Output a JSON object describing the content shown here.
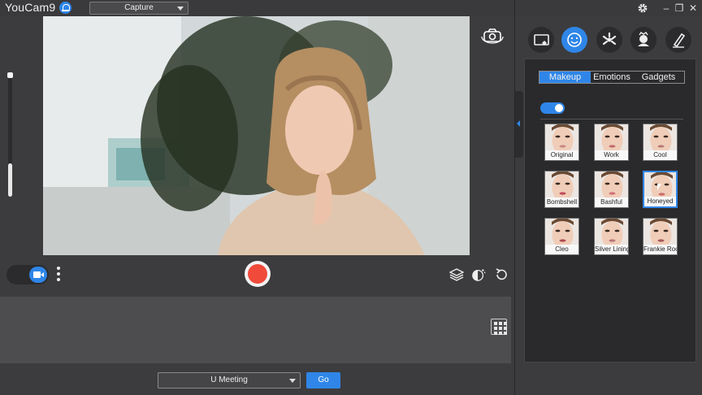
{
  "titlebar": {
    "app_title": "YouCam9",
    "mode": "Capture"
  },
  "window_controls": {
    "minimize": "–",
    "restore": "❐",
    "close": "✕"
  },
  "zoom_level": 0.27,
  "bottom": {
    "meeting_app": "U Meeting",
    "go_label": "Go"
  },
  "effects": {
    "categories": [
      "frame-icon",
      "face-icon",
      "particle-icon",
      "character-icon",
      "brush-icon"
    ],
    "active_category": 1,
    "tabs": [
      "Makeup",
      "Emotions",
      "Gadgets"
    ],
    "active_tab": 0,
    "makeup_enabled": true,
    "presets": [
      "Original",
      "Work",
      "Cool",
      "Bombshell",
      "Bashful",
      "Honeyed",
      "Cleo",
      "Silver Lining",
      "Frankie Rock"
    ],
    "selected_preset": 5
  },
  "colors": {
    "accent": "#2f86e8",
    "record": "#f04a3a",
    "background": "#3c3c3e",
    "panel": "#2a2a2c"
  }
}
